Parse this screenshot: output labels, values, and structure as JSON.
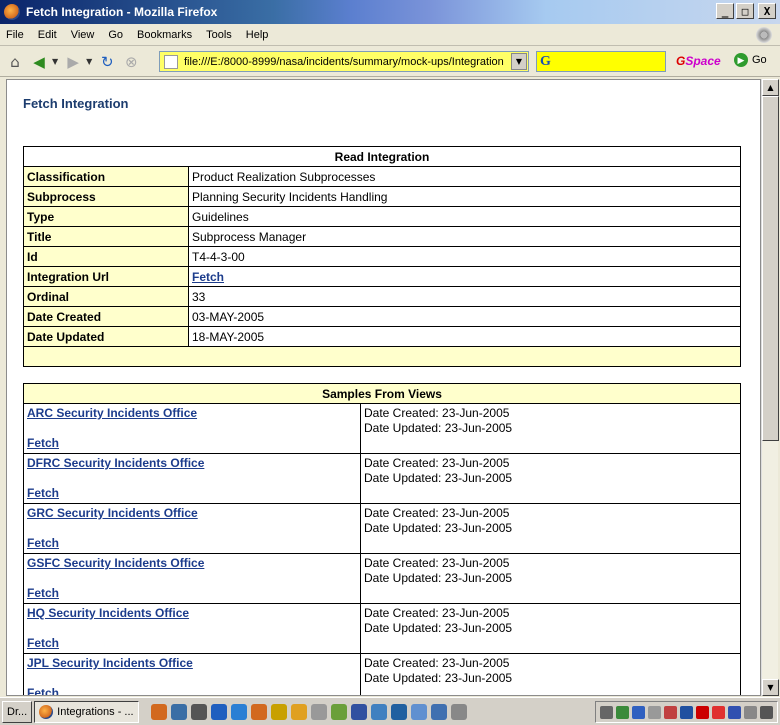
{
  "window": {
    "title": "Fetch Integration - Mozilla Firefox",
    "buttons": {
      "minimize": "_",
      "maximize": "□",
      "close": "X"
    }
  },
  "menu": [
    "File",
    "Edit",
    "View",
    "Go",
    "Bookmarks",
    "Tools",
    "Help"
  ],
  "nav": {
    "url": "file:///E:/8000-8999/nasa/incidents/summary/mock-ups/Integration",
    "search_placeholder": "",
    "gspace_g": "G",
    "gspace_rest": "Space",
    "go_label": "Go"
  },
  "page": {
    "title": "Fetch Integration",
    "read_table": {
      "header": "Read Integration",
      "rows": [
        {
          "label": "Classification",
          "value": "Product Realization Subprocesses"
        },
        {
          "label": "Subprocess",
          "value": "Planning Security Incidents Handling"
        },
        {
          "label": "Type",
          "value": "Guidelines"
        },
        {
          "label": "Title",
          "value": "Subprocess Manager"
        },
        {
          "label": "Id",
          "value": "T4-4-3-00"
        },
        {
          "label": "Integration Url",
          "value": "Fetch"
        },
        {
          "label": "Ordinal",
          "value": "33"
        },
        {
          "label": "Date Created",
          "value": "03-MAY-2005"
        },
        {
          "label": "Date Updated",
          "value": "18-MAY-2005"
        }
      ]
    },
    "samples_table": {
      "header": "Samples From Views",
      "rows": [
        {
          "office": "ARC Security Incidents Office",
          "fetch": "Fetch",
          "created": "Date Created: 23-Jun-2005",
          "updated": "Date Updated: 23-Jun-2005"
        },
        {
          "office": "DFRC Security Incidents Office",
          "fetch": "Fetch",
          "created": "Date Created: 23-Jun-2005",
          "updated": "Date Updated: 23-Jun-2005"
        },
        {
          "office": "GRC Security Incidents Office",
          "fetch": "Fetch",
          "created": "Date Created: 23-Jun-2005",
          "updated": "Date Updated: 23-Jun-2005"
        },
        {
          "office": "GSFC Security Incidents Office",
          "fetch": "Fetch",
          "created": "Date Created: 23-Jun-2005",
          "updated": "Date Updated: 23-Jun-2005"
        },
        {
          "office": "HQ Security Incidents Office",
          "fetch": "Fetch",
          "created": "Date Created: 23-Jun-2005",
          "updated": "Date Updated: 23-Jun-2005"
        },
        {
          "office": "JPL Security Incidents Office",
          "fetch": "Fetch",
          "created": "Date Created: 23-Jun-2005",
          "updated": "Date Updated: 23-Jun-2005"
        }
      ]
    }
  },
  "taskbar": {
    "tasks": [
      "Dr...",
      "Integrations - ..."
    ]
  },
  "colors": {
    "label_bg": "#ffffcc",
    "link": "#1c3c8c",
    "title": "#1c3c6e",
    "url_bg": "#ffff66"
  }
}
